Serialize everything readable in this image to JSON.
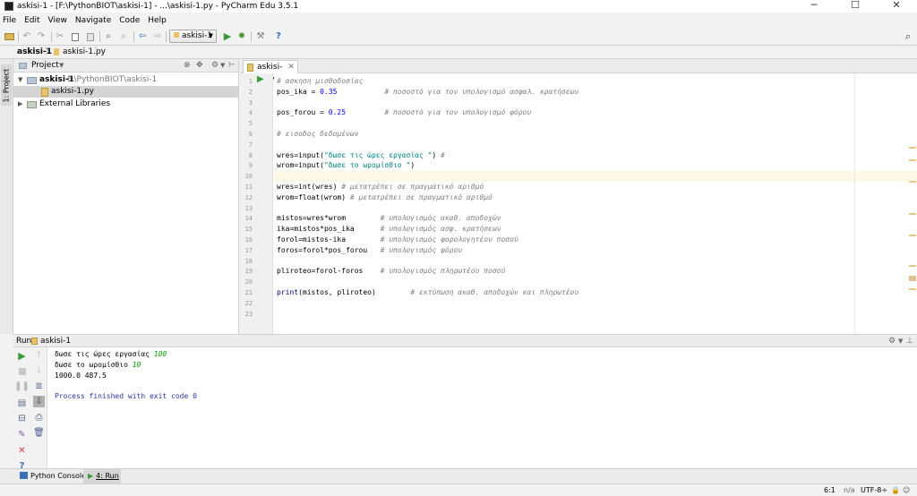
{
  "window": {
    "title": "askisi-1 - [F:\\PythonBIOT\\askisi-1] - ...\\askisi-1.py - PyCharm Edu 3.5.1",
    "minimize": "─",
    "maximize": "☐",
    "close": "✕"
  },
  "menu": [
    "File",
    "Edit",
    "View",
    "Navigate",
    "Code",
    "Help"
  ],
  "toolbar": {
    "run_config": "askisi-1"
  },
  "breadcrumb": [
    "askisi-1",
    "askisi-1.py"
  ],
  "side_tab": "1: Project",
  "project": {
    "header": "Project",
    "root_name": "askisi-1",
    "root_path": "F:\\PythonBIOT\\askisi-1",
    "file": "askisi-1.py",
    "libs": "External Libraries"
  },
  "editor": {
    "tab": "askisi-1.py",
    "lines": [
      {
        "n": "1",
        "p": [
          {
            "t": "# ασκηση μισθοδοσίας",
            "c": "c"
          }
        ]
      },
      {
        "n": "2",
        "p": [
          {
            "t": "pos_ika = ",
            "c": ""
          },
          {
            "t": "0.35",
            "c": "n"
          },
          {
            "t": "           ",
            "c": ""
          },
          {
            "t": "# ποσοστό για τον υπολογισμό ασφαλ. κρατήσεων",
            "c": "c"
          }
        ]
      },
      {
        "n": "3",
        "p": []
      },
      {
        "n": "4",
        "p": [
          {
            "t": "pos_forou = ",
            "c": ""
          },
          {
            "t": "0.25",
            "c": "n"
          },
          {
            "t": "         ",
            "c": ""
          },
          {
            "t": "# ποσοστό για τον υπολογισμό φόρου",
            "c": "c"
          }
        ]
      },
      {
        "n": "5",
        "p": []
      },
      {
        "n": "6",
        "p": [
          {
            "t": "# εισοδος δεδομένων",
            "c": "c"
          }
        ]
      },
      {
        "n": "7",
        "p": []
      },
      {
        "n": "8",
        "p": [
          {
            "t": "wres=input(",
            "c": ""
          },
          {
            "t": "\"δωσε τις ώρες εργασίας \"",
            "c": "s"
          },
          {
            "t": ") ",
            "c": ""
          },
          {
            "t": "#",
            "c": "c"
          }
        ]
      },
      {
        "n": "9",
        "p": [
          {
            "t": "wrom=input(",
            "c": ""
          },
          {
            "t": "\"δωσε το ωρομίσθιο \"",
            "c": "s"
          },
          {
            "t": ")",
            "c": ""
          }
        ]
      },
      {
        "n": "10",
        "p": []
      },
      {
        "n": "11",
        "p": [
          {
            "t": "wres=int(wres) ",
            "c": ""
          },
          {
            "t": "# μετατρέπει σε πραγματικό αριθμό",
            "c": "c"
          }
        ]
      },
      {
        "n": "12",
        "p": [
          {
            "t": "wrom=float(wrom) ",
            "c": ""
          },
          {
            "t": "# μετατρέπει σε πραγματικό αριθμό",
            "c": "c"
          }
        ]
      },
      {
        "n": "13",
        "p": []
      },
      {
        "n": "14",
        "p": [
          {
            "t": "mistos=wres*wrom        ",
            "c": ""
          },
          {
            "t": "# υπολογισμός ακαθ. αποδοχών",
            "c": "c"
          }
        ]
      },
      {
        "n": "15",
        "p": [
          {
            "t": "ika=mistos*pos_ika      ",
            "c": ""
          },
          {
            "t": "# υπολογισμός ασφ. κρατήσεων",
            "c": "c"
          }
        ]
      },
      {
        "n": "16",
        "p": [
          {
            "t": "forol=mistos-ika        ",
            "c": ""
          },
          {
            "t": "# υπολογισμός φορολογητέου ποσού",
            "c": "c"
          }
        ]
      },
      {
        "n": "17",
        "p": [
          {
            "t": "foros=forol*pos_forou   ",
            "c": ""
          },
          {
            "t": "# υπολογισμός φόρου",
            "c": "c"
          }
        ]
      },
      {
        "n": "18",
        "p": []
      },
      {
        "n": "19",
        "p": [
          {
            "t": "pliroteo=forol-foros    ",
            "c": ""
          },
          {
            "t": "# υπολογισμός πληρωτέου ποσού",
            "c": "c"
          }
        ]
      },
      {
        "n": "20",
        "p": []
      },
      {
        "n": "21",
        "p": [
          {
            "t": "print",
            "c": "k"
          },
          {
            "t": "(mistos, pliroteo)        ",
            "c": ""
          },
          {
            "t": "# εκτύπωση ακαθ. αποδοχών και πληρωτέου",
            "c": "c"
          }
        ]
      },
      {
        "n": "22",
        "p": []
      },
      {
        "n": "23",
        "p": []
      }
    ]
  },
  "run": {
    "label": "Run",
    "config": "askisi-1",
    "output": [
      {
        "p": [
          {
            "t": "δωσε τις ώρες εργασίας ",
            "c": ""
          },
          {
            "t": "100",
            "c": "green"
          }
        ]
      },
      {
        "p": [
          {
            "t": "δωσε το ωρομίσθιο ",
            "c": ""
          },
          {
            "t": "10",
            "c": "green"
          }
        ]
      },
      {
        "p": [
          {
            "t": "1000.0 487.5",
            "c": ""
          }
        ]
      },
      {
        "p": []
      },
      {
        "p": [
          {
            "t": "Process finished with exit code 0",
            "c": "blue"
          }
        ]
      }
    ]
  },
  "bottom_tabs": {
    "python_console": "Python Console",
    "run": "4: Run"
  },
  "status": {
    "position": "6:1",
    "line_sep": "n/a",
    "encoding": "UTF-8÷"
  }
}
